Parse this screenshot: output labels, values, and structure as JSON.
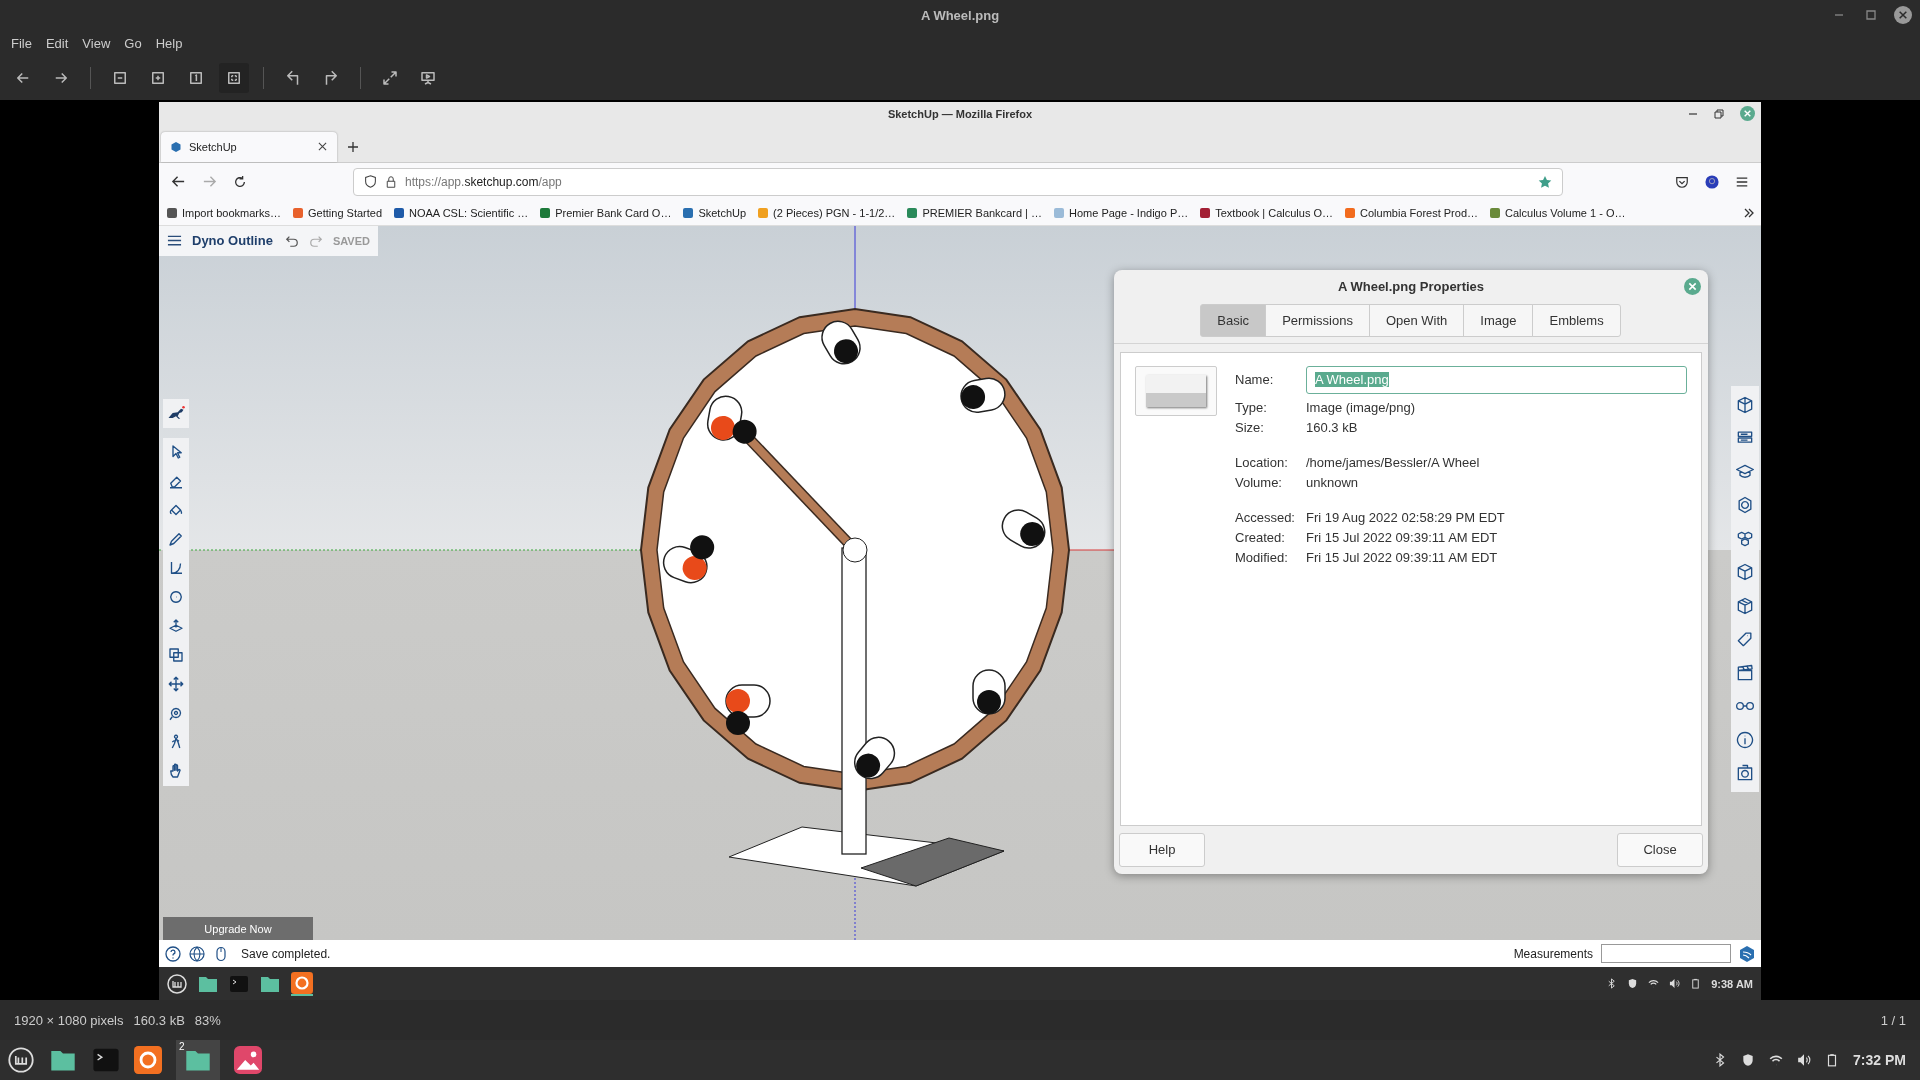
{
  "window": {
    "title": "A Wheel.png"
  },
  "menu": [
    "File",
    "Edit",
    "View",
    "Go",
    "Help"
  ],
  "screenshot": {
    "browser_title": "SketchUp — Mozilla Firefox",
    "tabs": [
      {
        "label": "SketchUp",
        "selected": true
      }
    ],
    "url": {
      "prefix": "https://app.",
      "domain": "sketchup.com",
      "path": "/app"
    },
    "bookmarks": [
      {
        "label": "Import bookmarks…",
        "color": "#555555"
      },
      {
        "label": "Getting Started",
        "color": "#e8612c"
      },
      {
        "label": "NOAA CSL: Scientific …",
        "color": "#1e5aa8"
      },
      {
        "label": "Premier Bank Card O…",
        "color": "#1d7a3a"
      },
      {
        "label": "SketchUp",
        "color": "#2a6fb0"
      },
      {
        "label": "(2 Pieces) PGN - 1-1/2…",
        "color": "#f0a020"
      },
      {
        "label": "PREMIER Bankcard | …",
        "color": "#2a8a5a"
      },
      {
        "label": "Home Page - Indigo P…",
        "color": "#9bbbd8"
      },
      {
        "label": "Textbook | Calculus O…",
        "color": "#a31f34"
      },
      {
        "label": "Columbia Forest Prod…",
        "color": "#f26b1d"
      },
      {
        "label": "Calculus Volume 1 - O…",
        "color": "#6a8a3a"
      }
    ],
    "sketchup": {
      "document": "Dyno Outline",
      "save_state": "SAVED",
      "upgrade": "Upgrade Now",
      "status": "Save completed.",
      "measurements_label": "Measurements"
    },
    "dialog": {
      "title": "A Wheel.png Properties",
      "tabs": [
        {
          "label": "Basic",
          "selected": true
        },
        {
          "label": "Permissions",
          "selected": false
        },
        {
          "label": "Open With",
          "selected": false
        },
        {
          "label": "Image",
          "selected": false
        },
        {
          "label": "Emblems",
          "selected": false
        }
      ],
      "name_label": "Name:",
      "name_value": "A Wheel.png",
      "name_text_selected": true,
      "groups": [
        [
          {
            "label": "Type:",
            "value": "Image (image/png)"
          },
          {
            "label": "Size:",
            "value": "160.3 kB"
          }
        ],
        [
          {
            "label": "Location:",
            "value": "/home/james/Bessler/A Wheel"
          },
          {
            "label": "Volume:",
            "value": "unknown"
          }
        ],
        [
          {
            "label": "Accessed:",
            "value": "Fri 19 Aug 2022 02:58:29 PM EDT"
          },
          {
            "label": "Created:",
            "value": "Fri 15 Jul 2022 09:39:11 AM EDT"
          },
          {
            "label": "Modified:",
            "value": "Fri 15 Jul 2022 09:39:11 AM EDT"
          }
        ]
      ],
      "buttons": [
        "Help",
        "Close"
      ]
    },
    "clock": "9:38 AM"
  },
  "status": {
    "dimensions": "1920 × 1080 pixels",
    "size": "160.3 kB",
    "zoom": "83%",
    "page": "1 / 1"
  },
  "taskbar": {
    "window_count": "2",
    "clock": "7:32 PM"
  }
}
